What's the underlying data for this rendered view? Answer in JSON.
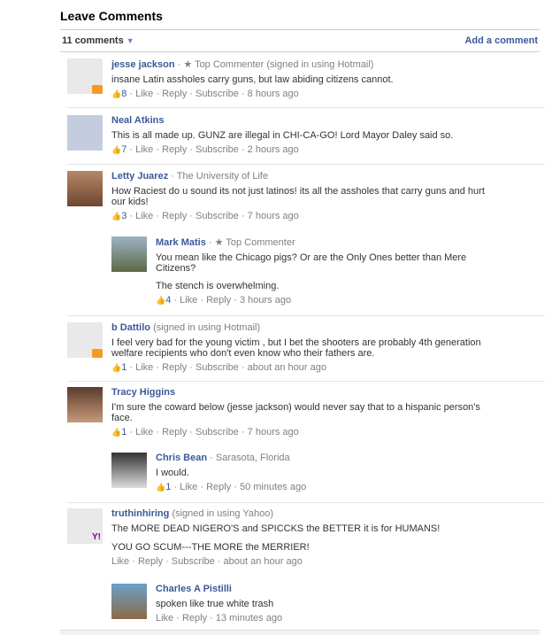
{
  "title": "Leave Comments",
  "count": "11 comments",
  "add": "Add a comment",
  "comments": [
    {
      "name": "jesse jackson",
      "meta": "· ★ Top Commenter (signed in using Hotmail)",
      "text": "insane Latin assholes carry guns, but law abiding citizens cannot.",
      "likes": "8",
      "actions": "· Like · Reply · Subscribe · 8 hours ago"
    },
    {
      "name": "Neal Atkins",
      "meta": "",
      "text": "This is all made up. GUNZ are illegal in CHI-CA-GO! Lord Mayor Daley said so.",
      "likes": "7",
      "actions": "· Like · Reply · Subscribe · 2 hours ago"
    },
    {
      "name": "Letty Juarez",
      "meta": "· The University of Life",
      "text": "How Raciest do u sound its not just latinos! its all the assholes that carry guns and hurt our kids!",
      "likes": "3",
      "actions": "· Like · Reply · Subscribe · 7 hours ago"
    },
    {
      "name": "Mark Matis",
      "meta": "· ★ Top Commenter",
      "text": "You mean like the Chicago pigs? Or are the Only Ones better than Mere Citizens?",
      "text2": "The stench is overwhelming.",
      "likes": "4",
      "actions": "· Like · Reply · 3 hours ago"
    },
    {
      "name": "b Dattilo",
      "meta": "(signed in using Hotmail)",
      "text": "I feel very bad for the young victim , but I bet the shooters are probably 4th generation welfare recipients who don't even know who their fathers are.",
      "likes": "1",
      "actions": "· Like · Reply · Subscribe · about an hour ago"
    },
    {
      "name": "Tracy Higgins",
      "meta": "",
      "text": "I'm sure the coward below (jesse jackson) would never say that to a hispanic person's face.",
      "likes": "1",
      "actions": "· Like · Reply · Subscribe · 7 hours ago"
    },
    {
      "name": "Chris Bean",
      "meta": "· Sarasota, Florida",
      "text": "I would.",
      "likes": "1",
      "actions": "· Like · Reply · 50 minutes ago"
    },
    {
      "name": "truthinhiring",
      "meta": "(signed in using Yahoo)",
      "text": "The MORE DEAD NIGERO'S and SPICCKS the BETTER it is for HUMANS!",
      "text2": "YOU GO SCUM---THE MORE the MERRIER!",
      "actions": "Like · Reply · Subscribe · about an hour ago"
    },
    {
      "name": "Charles A Pistilli",
      "meta": "",
      "text": "spoken like true white trash",
      "actions": "Like · Reply · 13 minutes ago"
    }
  ]
}
